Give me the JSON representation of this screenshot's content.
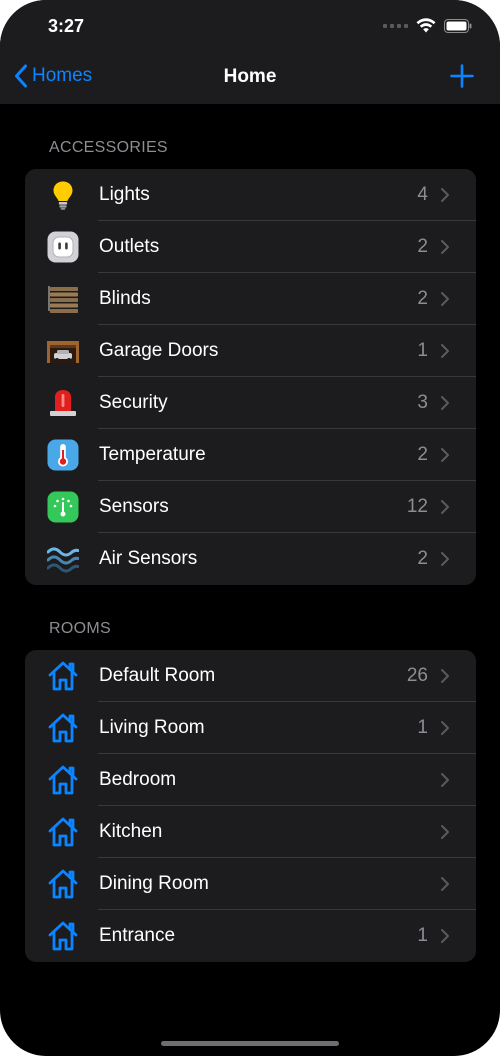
{
  "status_bar": {
    "time": "3:27"
  },
  "nav": {
    "back_label": "Homes",
    "title": "Home",
    "add_icon": "plus-icon"
  },
  "accessories": {
    "header": "ACCESSORIES",
    "items": [
      {
        "label": "Lights",
        "count": "4",
        "icon": "lightbulb-icon"
      },
      {
        "label": "Outlets",
        "count": "2",
        "icon": "outlet-icon"
      },
      {
        "label": "Blinds",
        "count": "2",
        "icon": "blinds-icon"
      },
      {
        "label": "Garage Doors",
        "count": "1",
        "icon": "garage-door-icon"
      },
      {
        "label": "Security",
        "count": "3",
        "icon": "alarm-light-icon"
      },
      {
        "label": "Temperature",
        "count": "2",
        "icon": "thermometer-icon"
      },
      {
        "label": "Sensors",
        "count": "12",
        "icon": "sensor-gauge-icon"
      },
      {
        "label": "Air Sensors",
        "count": "2",
        "icon": "air-waves-icon"
      }
    ]
  },
  "rooms": {
    "header": "ROOMS",
    "items": [
      {
        "label": "Default Room",
        "count": "26",
        "icon": "house-icon"
      },
      {
        "label": "Living Room",
        "count": "1",
        "icon": "house-icon"
      },
      {
        "label": "Bedroom",
        "count": "",
        "icon": "house-icon"
      },
      {
        "label": "Kitchen",
        "count": "",
        "icon": "house-icon"
      },
      {
        "label": "Dining Room",
        "count": "",
        "icon": "house-icon"
      },
      {
        "label": "Entrance",
        "count": "1",
        "icon": "house-icon"
      }
    ]
  },
  "colors": {
    "accent": "#0a84ff",
    "background": "#000000",
    "cell": "#1c1c1e",
    "secondary_text": "#8d8d93"
  }
}
